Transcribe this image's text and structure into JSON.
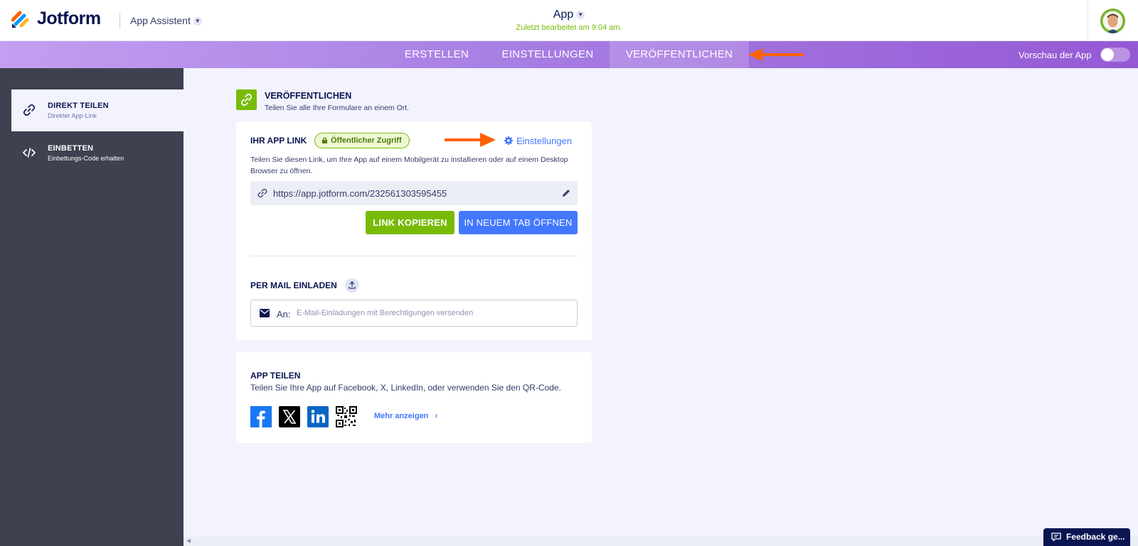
{
  "header": {
    "brand": "Jotform",
    "assistant_label": "App Assistent",
    "app_title": "App",
    "last_edited": "Zuletzt bearbeitet am 9:04 am."
  },
  "nav": {
    "tabs": [
      {
        "label": "ERSTELLEN"
      },
      {
        "label": "EINSTELLUNGEN"
      },
      {
        "label": "VERÖFFENTLICHEN"
      }
    ],
    "preview_label": "Vorschau der App"
  },
  "sidebar": {
    "items": [
      {
        "title": "DIREKT TEILEN",
        "subtitle": "Direkter App-Link"
      },
      {
        "title": "EINBETTEN",
        "subtitle": "Einbettungs-Code erhalten"
      }
    ]
  },
  "publish": {
    "title": "VERÖFFENTLICHEN",
    "subtitle": "Teilen Sie alle Ihre Formulare an einem Ort."
  },
  "app_link": {
    "heading": "IHR APP LINK",
    "badge": "Öffentlicher Zugriff",
    "settings_label": "Einstellungen",
    "description": "Teilen Sie diesen Link, um Ihre App auf einem Mobilgerät zu installieren oder auf einem Desktop Browser zu öffnen.",
    "url": "https://app.jotform.com/232561303595455",
    "copy_button": "LINK KOPIEREN",
    "open_button": "IN NEUEM TAB ÖFFNEN"
  },
  "mail_invite": {
    "heading": "PER MAIL EINLADEN",
    "to_label": "An:",
    "placeholder": "E-Mail-Einladungen mit Berechtigungen versenden"
  },
  "share": {
    "heading": "APP TEILEN",
    "subtitle": "Teilen Sie Ihre App auf Facebook, X, LinkedIn, oder verwenden Sie den QR-Code.",
    "more_label": "Mehr anzeigen"
  },
  "feedback": {
    "label": "Feedback ge..."
  },
  "colors": {
    "accent_green": "#78bb07",
    "accent_blue": "#4277ff",
    "nav_purple": "#9559d4",
    "annotation_orange": "#ff6100"
  }
}
